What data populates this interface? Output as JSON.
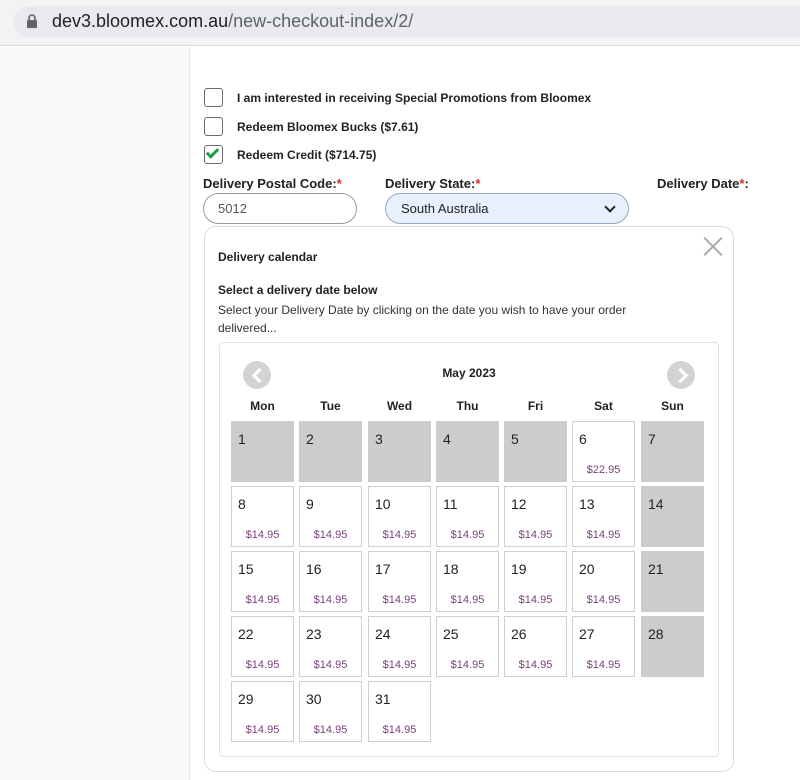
{
  "browser": {
    "url_domain": "dev3.bloomex.com.au",
    "url_path": "/new-checkout-index/2/"
  },
  "checkout": {
    "options": [
      {
        "label": "I am interested in receiving Special Promotions from Bloomex",
        "checked": false
      },
      {
        "label": "Redeem Bloomex Bucks ($7.61)",
        "checked": false
      },
      {
        "label": "Redeem Credit ($714.75)",
        "checked": true
      }
    ],
    "postal_label": "Delivery Postal Code:",
    "postal_value": "5012",
    "state_label": "Delivery State:",
    "state_value": "South Australia",
    "date_label": "Delivery Date",
    "required_mark": "*",
    "date_colon": ":"
  },
  "calendar": {
    "title": "Delivery calendar",
    "subtitle": "Select a delivery date below",
    "description": "Select your Delivery Date by clicking on the date you wish to have your order delivered...",
    "month": "May 2023",
    "weekdays": [
      "Mon",
      "Tue",
      "Wed",
      "Thu",
      "Fri",
      "Sat",
      "Sun"
    ],
    "days": [
      {
        "d": "1",
        "price": "",
        "available": false
      },
      {
        "d": "2",
        "price": "",
        "available": false
      },
      {
        "d": "3",
        "price": "",
        "available": false
      },
      {
        "d": "4",
        "price": "",
        "available": false
      },
      {
        "d": "5",
        "price": "",
        "available": false
      },
      {
        "d": "6",
        "price": "$22.95",
        "available": true
      },
      {
        "d": "7",
        "price": "",
        "available": false
      },
      {
        "d": "8",
        "price": "$14.95",
        "available": true
      },
      {
        "d": "9",
        "price": "$14.95",
        "available": true
      },
      {
        "d": "10",
        "price": "$14.95",
        "available": true
      },
      {
        "d": "11",
        "price": "$14.95",
        "available": true
      },
      {
        "d": "12",
        "price": "$14.95",
        "available": true
      },
      {
        "d": "13",
        "price": "$14.95",
        "available": true
      },
      {
        "d": "14",
        "price": "",
        "available": false
      },
      {
        "d": "15",
        "price": "$14.95",
        "available": true
      },
      {
        "d": "16",
        "price": "$14.95",
        "available": true
      },
      {
        "d": "17",
        "price": "$14.95",
        "available": true
      },
      {
        "d": "18",
        "price": "$14.95",
        "available": true
      },
      {
        "d": "19",
        "price": "$14.95",
        "available": true
      },
      {
        "d": "20",
        "price": "$14.95",
        "available": true
      },
      {
        "d": "21",
        "price": "",
        "available": false
      },
      {
        "d": "22",
        "price": "$14.95",
        "available": true
      },
      {
        "d": "23",
        "price": "$14.95",
        "available": true
      },
      {
        "d": "24",
        "price": "$14.95",
        "available": true
      },
      {
        "d": "25",
        "price": "$14.95",
        "available": true
      },
      {
        "d": "26",
        "price": "$14.95",
        "available": true
      },
      {
        "d": "27",
        "price": "$14.95",
        "available": true
      },
      {
        "d": "28",
        "price": "",
        "available": false
      },
      {
        "d": "29",
        "price": "$14.95",
        "available": true
      },
      {
        "d": "30",
        "price": "$14.95",
        "available": true
      },
      {
        "d": "31",
        "price": "$14.95",
        "available": true
      }
    ]
  }
}
